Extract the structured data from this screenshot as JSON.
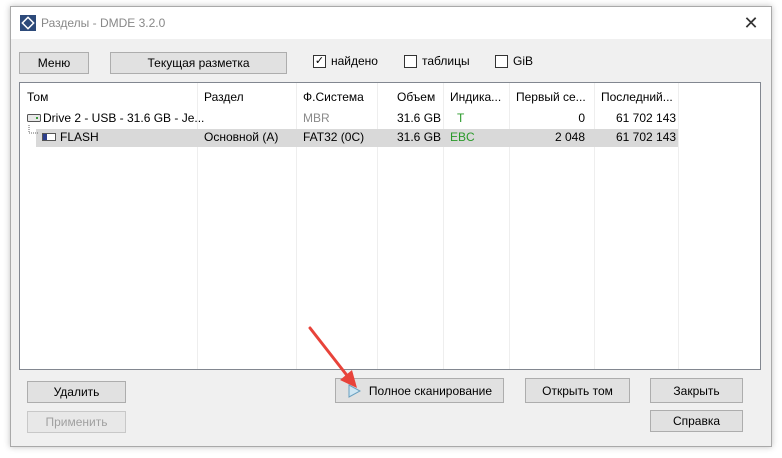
{
  "window": {
    "title": "Разделы - DMDE 3.2.0",
    "close": "✕"
  },
  "toolbar": {
    "menu": "Меню",
    "current_layout": "Текущая разметка",
    "found": {
      "label": "найдено",
      "checked": true,
      "mark": "✓"
    },
    "tables": {
      "label": "таблицы",
      "checked": false
    },
    "gib": {
      "label": "GiB",
      "checked": false
    }
  },
  "table": {
    "headers": [
      "Том",
      "Раздел",
      "Ф.Система",
      "Объем",
      "Индика...",
      "Первый се...",
      "Последний..."
    ],
    "rows": [
      {
        "volume": "Drive 2 - USB - 31.6 GB - Je...",
        "partition": "",
        "fs": "MBR",
        "size": "31.6 GB",
        "indicator": "T",
        "first": "0",
        "last": "61 702 143"
      },
      {
        "volume": "FLASH",
        "partition": "Основной (A)",
        "fs": "FAT32 (0C)",
        "size": "31.6 GB",
        "indicator": "EBC",
        "first": "2 048",
        "last": "61 702 143"
      }
    ]
  },
  "buttons": {
    "delete": "Удалить",
    "apply": "Применить",
    "full_scan": "Полное сканирование",
    "open_volume": "Открыть том",
    "close": "Закрыть",
    "help": "Справка"
  },
  "colors": {
    "indicator_green": "#2a9a2a",
    "annotation_arrow": "#e8433a"
  }
}
